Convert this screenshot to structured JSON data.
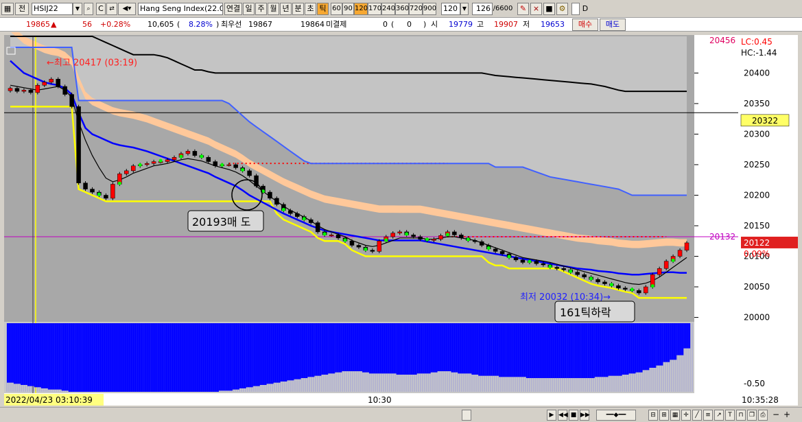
{
  "toolbar": {
    "mode_label": "전",
    "symbol": "HSIJ22",
    "instrument": "Hang Seng Index(22.0",
    "tabs": [
      "연결",
      "일",
      "주",
      "월",
      "년",
      "분",
      "초",
      "틱"
    ],
    "active_tab": "틱",
    "intervals": [
      "60",
      "90",
      "120",
      "170",
      "240",
      "360",
      "720",
      "900"
    ],
    "active_interval": "120",
    "interval_value": "120",
    "count_value": "126",
    "count_total": "/6600",
    "checkbox_label": "D"
  },
  "quote": {
    "price": "19865",
    "change": "56",
    "change_pct": "+0.28%",
    "volume": "10,605",
    "volume_ratio": "8.28%",
    "best_label": "최우선",
    "best_ask": "19867",
    "best_bid": "19864",
    "unsettled_label": "미결제",
    "unsettled_value": "0",
    "unsettled_change": "0",
    "open_label": "시",
    "open": "19779",
    "high_label": "고",
    "high": "19907",
    "low_label": "저",
    "low": "19653",
    "buy_label": "매수",
    "sell_label": "매도"
  },
  "chart_data": {
    "type": "candlestick",
    "price_axis_ticks": [
      "20400",
      "20350",
      "20300",
      "20250",
      "20200",
      "20150",
      "20100",
      "20050",
      "20000"
    ],
    "price_ylim": [
      19995,
      20460
    ],
    "indicator_ticks": [
      "-0.50"
    ],
    "time_labels": [
      "10:30"
    ],
    "date_label": "2022/04/23 03:10:39",
    "time_readout": "10:35:28",
    "top_value": "20456",
    "lc_label": "LC:0.45",
    "hc_label": "HC:-1.44",
    "cursor_price": "20322",
    "current_price": "20122",
    "current_change": "0.09%",
    "left_marker_price": "20132",
    "high_annotation": "최고 20417 (03:19)",
    "low_annotation": "최저 20032 (10:34)",
    "callout_sell": "20193매 도",
    "callout_drop": "161틱하락",
    "closes": [
      20375,
      20370,
      20372,
      20368,
      20380,
      20385,
      20390,
      20378,
      20365,
      20345,
      20220,
      20210,
      20205,
      20200,
      20195,
      20218,
      20235,
      20240,
      20248,
      20250,
      20252,
      20255,
      20255,
      20258,
      20262,
      20268,
      20272,
      20265,
      20262,
      20255,
      20248,
      20250,
      20250,
      20245,
      20240,
      20232,
      20215,
      20205,
      20195,
      20185,
      20175,
      20170,
      20165,
      20160,
      20155,
      20140,
      20135,
      20135,
      20130,
      20125,
      20118,
      20115,
      20110,
      20108,
      20125,
      20132,
      20138,
      20140,
      20135,
      20132,
      20128,
      20126,
      20128,
      20134,
      20140,
      20135,
      20130,
      20126,
      20124,
      20118,
      20112,
      20108,
      20104,
      20098,
      20094,
      20090,
      20092,
      20088,
      20086,
      20082,
      20080,
      20078,
      20074,
      20070,
      20066,
      20062,
      20058,
      20055,
      20052,
      20048,
      20046,
      20044,
      20040,
      20050,
      20070,
      20080,
      20092,
      20100,
      20110,
      20122
    ],
    "ma_blue": [
      20420,
      20410,
      20400,
      20395,
      20390,
      20385,
      20382,
      20380,
      20375,
      20365,
      20335,
      20310,
      20300,
      20295,
      20290,
      20285,
      20282,
      20280,
      20278,
      20275,
      20272,
      20268,
      20264,
      20260,
      20256,
      20252,
      20248,
      20244,
      20240,
      20236,
      20230,
      20225,
      20220,
      20215,
      20208,
      20200,
      20194,
      20188,
      20182,
      20176,
      20170,
      20165,
      20160,
      20155,
      20150,
      20146,
      20142,
      20140,
      20138,
      20136,
      20134,
      20132,
      20130,
      20128,
      20126,
      20126,
      20126,
      20126,
      20126,
      20126,
      20126,
      20124,
      20122,
      20120,
      20118,
      20116,
      20114,
      20112,
      20110,
      20108,
      20106,
      20104,
      20102,
      20100,
      20098,
      20096,
      20094,
      20092,
      20090,
      20088,
      20086,
      20084,
      20082,
      20080,
      20079,
      20078,
      20076,
      20075,
      20074,
      20072,
      20071,
      20070,
      20070,
      20071,
      20072,
      20073,
      20074,
      20074,
      20073,
      20073
    ],
    "ma_black": [
      20380,
      20378,
      20376,
      20374,
      20372,
      20374,
      20376,
      20378,
      20372,
      20360,
      20320,
      20290,
      20265,
      20245,
      20228,
      20222,
      20225,
      20230,
      20236,
      20240,
      20244,
      20248,
      20250,
      20252,
      20255,
      20258,
      20260,
      20258,
      20256,
      20252,
      20248,
      20245,
      20242,
      20238,
      20232,
      20224,
      20215,
      20206,
      20198,
      20190,
      20182,
      20175,
      20170,
      20164,
      20158,
      20150,
      20144,
      20140,
      20136,
      20132,
      20126,
      20122,
      20118,
      20116,
      20118,
      20122,
      20126,
      20130,
      20130,
      20130,
      20130,
      20128,
      20128,
      20130,
      20132,
      20132,
      20130,
      20128,
      20126,
      20122,
      20118,
      20114,
      20110,
      20106,
      20102,
      20098,
      20096,
      20094,
      20092,
      20090,
      20087,
      20084,
      20081,
      20078,
      20075,
      20072,
      20069,
      20066,
      20063,
      20060,
      20057,
      20055,
      20054,
      20056,
      20060,
      20066,
      20074,
      20082,
      20090,
      20098
    ],
    "upper_black": [
      20460,
      20460,
      20460,
      20460,
      20460,
      20460,
      20460,
      20460,
      20460,
      20460,
      20460,
      20460,
      20460,
      20455,
      20450,
      20445,
      20440,
      20435,
      20430,
      20430,
      20430,
      20430,
      20428,
      20425,
      20420,
      20415,
      20410,
      20405,
      20405,
      20402,
      20400,
      20400,
      20400,
      20400,
      20400,
      20400,
      20400,
      20400,
      20400,
      20400,
      20400,
      20400,
      20400,
      20400,
      20400,
      20400,
      20400,
      20400,
      20400,
      20400,
      20400,
      20400,
      20400,
      20400,
      20400,
      20400,
      20400,
      20400,
      20400,
      20400,
      20400,
      20400,
      20400,
      20400,
      20400,
      20400,
      20400,
      20400,
      20400,
      20400,
      20398,
      20396,
      20395,
      20394,
      20393,
      20392,
      20391,
      20390,
      20389,
      20388,
      20387,
      20386,
      20385,
      20384,
      20383,
      20382,
      20380,
      20378,
      20375,
      20372,
      20370,
      20370,
      20370,
      20370,
      20370,
      20370,
      20370,
      20370,
      20370,
      20370
    ],
    "upper_blue": [
      20442,
      20442,
      20442,
      20442,
      20442,
      20442,
      20442,
      20442,
      20442,
      20442,
      20355,
      20355,
      20355,
      20355,
      20355,
      20355,
      20355,
      20355,
      20355,
      20355,
      20355,
      20355,
      20355,
      20355,
      20355,
      20355,
      20355,
      20355,
      20355,
      20355,
      20355,
      20355,
      20350,
      20340,
      20330,
      20320,
      20312,
      20304,
      20296,
      20288,
      20280,
      20272,
      20264,
      20256,
      20252,
      20252,
      20252,
      20252,
      20252,
      20252,
      20252,
      20252,
      20252,
      20252,
      20252,
      20252,
      20252,
      20252,
      20252,
      20252,
      20252,
      20252,
      20252,
      20252,
      20252,
      20252,
      20252,
      20252,
      20252,
      20252,
      20252,
      20246,
      20246,
      20246,
      20246,
      20246,
      20242,
      20238,
      20234,
      20230,
      20228,
      20226,
      20224,
      20222,
      20220,
      20218,
      20216,
      20214,
      20212,
      20210,
      20205,
      20200,
      20200,
      20200,
      20200,
      20200,
      20200,
      20200,
      20200,
      20200
    ],
    "stop_yellow": [
      20345,
      20345,
      20345,
      20345,
      20345,
      20345,
      20345,
      20345,
      20345,
      20345,
      20210,
      20205,
      20200,
      20195,
      20190,
      20190,
      20190,
      20190,
      20190,
      20190,
      20190,
      20190,
      20190,
      20190,
      20190,
      20190,
      20190,
      20190,
      20190,
      20190,
      20190,
      20190,
      20190,
      20190,
      20190,
      20190,
      20190,
      20190,
      20190,
      20170,
      20160,
      20155,
      20150,
      20145,
      20140,
      20130,
      20125,
      20125,
      20125,
      20120,
      20110,
      20105,
      20100,
      20100,
      20100,
      20100,
      20100,
      20100,
      20100,
      20100,
      20100,
      20100,
      20100,
      20100,
      20100,
      20100,
      20100,
      20100,
      20100,
      20100,
      20090,
      20085,
      20085,
      20080,
      20080,
      20080,
      20080,
      20080,
      20080,
      20080,
      20080,
      20075,
      20070,
      20065,
      20060,
      20055,
      20052,
      20050,
      20048,
      20045,
      20042,
      20040,
      20032,
      20032,
      20032,
      20032,
      20032,
      20032,
      20032,
      20032
    ],
    "dotted_level_1": 20252,
    "dotted_level_2": 20132,
    "horizontal_line": 20335,
    "indicator_values": [
      -0.92,
      -0.93,
      -0.94,
      -0.95,
      -0.96,
      -0.97,
      -0.98,
      -0.98,
      -0.99,
      -1.0,
      -1.0,
      -1.0,
      -1.0,
      -1.0,
      -1.0,
      -1.0,
      -1.0,
      -1.0,
      -1.0,
      -1.0,
      -1.0,
      -1.0,
      -1.0,
      -1.0,
      -1.0,
      -1.0,
      -1.0,
      -1.0,
      -1.0,
      -1.0,
      -1.0,
      -0.99,
      -0.99,
      -0.98,
      -0.97,
      -0.96,
      -0.95,
      -0.94,
      -0.93,
      -0.92,
      -0.91,
      -0.9,
      -0.89,
      -0.88,
      -0.87,
      -0.86,
      -0.85,
      -0.84,
      -0.83,
      -0.82,
      -0.82,
      -0.82,
      -0.83,
      -0.84,
      -0.84,
      -0.84,
      -0.84,
      -0.85,
      -0.85,
      -0.85,
      -0.84,
      -0.84,
      -0.83,
      -0.82,
      -0.82,
      -0.83,
      -0.84,
      -0.84,
      -0.85,
      -0.86,
      -0.86,
      -0.86,
      -0.87,
      -0.87,
      -0.87,
      -0.87,
      -0.88,
      -0.88,
      -0.88,
      -0.88,
      -0.88,
      -0.88,
      -0.88,
      -0.88,
      -0.88,
      -0.88,
      -0.87,
      -0.87,
      -0.86,
      -0.86,
      -0.85,
      -0.84,
      -0.83,
      -0.81,
      -0.79,
      -0.77,
      -0.74,
      -0.72,
      -0.68,
      -0.62
    ],
    "indicator_ylim": [
      -1.0,
      -0.4
    ]
  },
  "colors": {
    "up": "#ff0000",
    "down": "#000000",
    "ma_blue": "#0000ff",
    "stop_yellow": "#ffff00",
    "cloud_orange": "#ffc89a",
    "plot_bg": "#a8a8a8",
    "indicator_bar": "#0000ff"
  }
}
